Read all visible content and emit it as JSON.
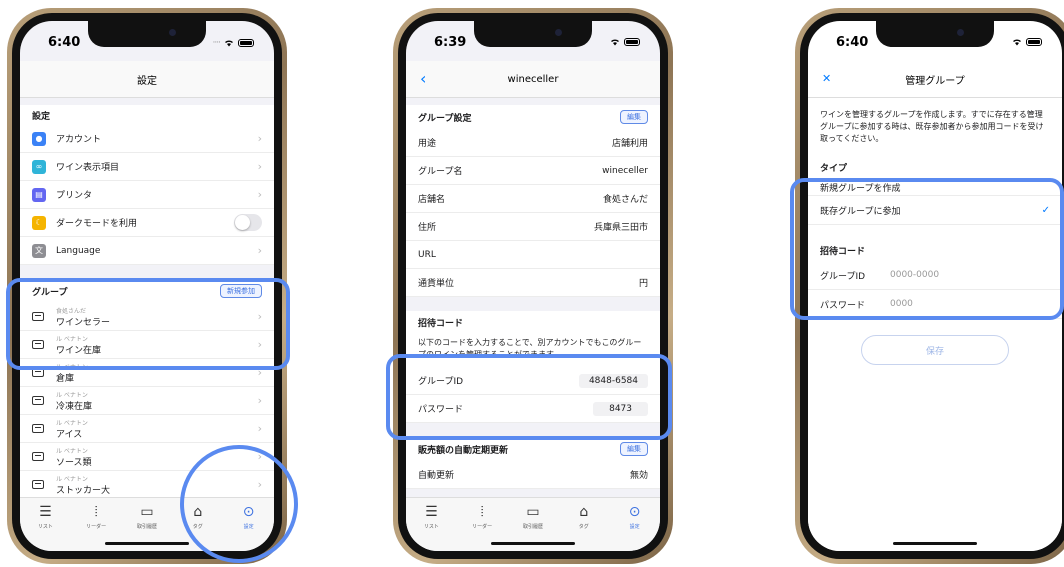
{
  "screens": [
    {
      "time": "6:40",
      "title": "設定",
      "settings_header": "設定",
      "settings_items": [
        {
          "label": "アカウント",
          "icon": "account-icon",
          "color": "#3b82f6"
        },
        {
          "label": "ワイン表示項目",
          "icon": "wine-display-icon",
          "color": "#2fb4d8"
        },
        {
          "label": "プリンタ",
          "icon": "printer-icon",
          "color": "#6366f1"
        },
        {
          "label": "ダークモードを利用",
          "icon": "moon-icon",
          "color": "#f5b400"
        },
        {
          "label": "Language",
          "icon": "translate-icon",
          "color": "#8e8e93"
        }
      ],
      "group_header": "グループ",
      "join_button": "新規参加",
      "groups": [
        {
          "sub": "食処さんだ",
          "name": "ワインセラー"
        },
        {
          "sub": "ル ベナトン",
          "name": "ワイン在庫"
        },
        {
          "sub": "ル ベナトン",
          "name": "倉庫"
        },
        {
          "sub": "ル ベナトン",
          "name": "冷凍在庫"
        },
        {
          "sub": "ル ベナトン",
          "name": "アイス"
        },
        {
          "sub": "ル ベナトン",
          "name": "ソース類"
        },
        {
          "sub": "ル ベナトン",
          "name": "ストッカー大"
        }
      ],
      "tabs": [
        "リスト",
        "リーダー",
        "取引履歴",
        "タグ",
        "設定"
      ]
    },
    {
      "time": "6:39",
      "title": "wineceller",
      "group_settings_header": "グループ設定",
      "edit_label": "編集",
      "fields": [
        {
          "label": "用途",
          "value": "店舗利用"
        },
        {
          "label": "グループ名",
          "value": "wineceller"
        },
        {
          "label": "店舗名",
          "value": "食処さんだ"
        },
        {
          "label": "住所",
          "value": "兵庫県三田市"
        },
        {
          "label": "URL",
          "value": ""
        },
        {
          "label": "通貨単位",
          "value": "円"
        }
      ],
      "invite_header": "招待コード",
      "invite_desc": "以下のコードを入力することで、別アカウントでもこのグループのワインを管理することができます。",
      "group_id_label": "グループID",
      "group_id_value": "4848-6584",
      "password_label": "パスワード",
      "password_value": "8473",
      "auto_update_header": "販売額の自動定期更新",
      "auto_update_edit": "編集",
      "auto_update_label": "自動更新",
      "auto_update_value": "無効",
      "tabs": [
        "リスト",
        "リーダー",
        "取引履歴",
        "タグ",
        "設定"
      ]
    },
    {
      "time": "6:40",
      "title": "管理グループ",
      "close": "✕",
      "desc": "ワインを管理するグループを作成します。すでに存在する管理グループに参加する時は、既存参加者から参加用コードを受け取ってください。",
      "type_header": "タイプ",
      "option_new": "新規グループを作成",
      "option_join": "既存グループに参加",
      "invite_header": "招待コード",
      "group_id_label": "グループID",
      "group_id_placeholder": "0000-0000",
      "password_label": "パスワード",
      "password_placeholder": "0000",
      "save": "保存"
    }
  ]
}
